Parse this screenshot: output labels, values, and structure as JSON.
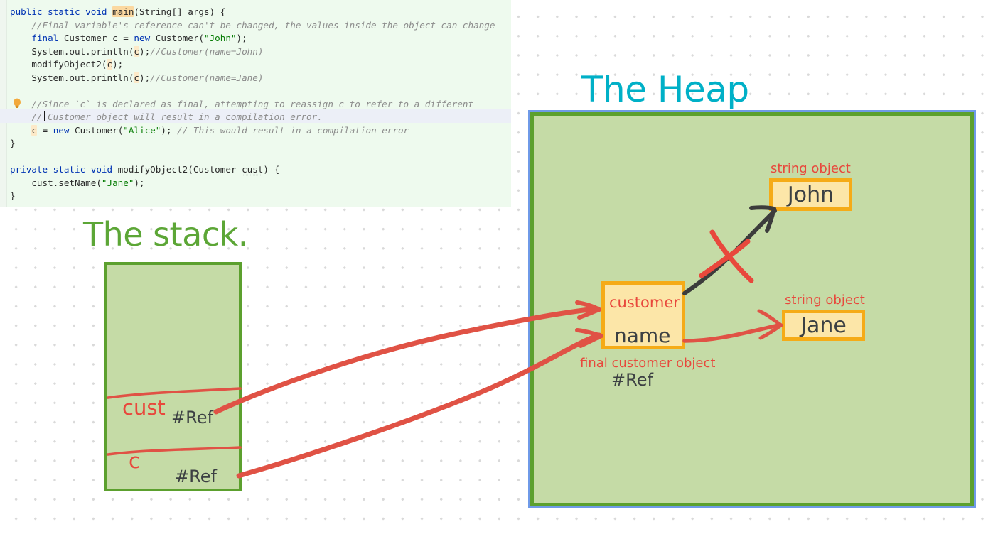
{
  "code": {
    "lines": [
      {
        "indent": 0,
        "tokens": [
          {
            "t": "public ",
            "c": "kw"
          },
          {
            "t": "static ",
            "c": "kw"
          },
          {
            "t": "void ",
            "c": "kw"
          },
          {
            "t": "main",
            "c": "hl-word"
          },
          {
            "t": "(String[] args) {",
            "c": "ident"
          }
        ]
      },
      {
        "indent": 1,
        "tokens": [
          {
            "t": "//Final variable's reference can't be changed, the values inside the object can change",
            "c": "cmt"
          }
        ]
      },
      {
        "indent": 1,
        "tokens": [
          {
            "t": "final ",
            "c": "kw"
          },
          {
            "t": "Customer c = ",
            "c": "ident"
          },
          {
            "t": "new ",
            "c": "kw"
          },
          {
            "t": "Customer(",
            "c": "ident"
          },
          {
            "t": "\"John\"",
            "c": "str"
          },
          {
            "t": ");",
            "c": "ident"
          }
        ]
      },
      {
        "indent": 1,
        "tokens": [
          {
            "t": "System.out.println(",
            "c": "ident"
          },
          {
            "t": "c",
            "c": "hl-soft"
          },
          {
            "t": ");",
            "c": "ident"
          },
          {
            "t": "//Customer(name=John)",
            "c": "cmt"
          }
        ]
      },
      {
        "indent": 1,
        "tokens": [
          {
            "t": "modifyObject2(",
            "c": "ident"
          },
          {
            "t": "c",
            "c": "hl-soft"
          },
          {
            "t": ");",
            "c": "ident"
          }
        ]
      },
      {
        "indent": 1,
        "tokens": [
          {
            "t": "System.out.println(",
            "c": "ident"
          },
          {
            "t": "c",
            "c": "hl-soft"
          },
          {
            "t": ");",
            "c": "ident"
          },
          {
            "t": "//Customer(name=Jane)",
            "c": "cmt"
          }
        ]
      },
      {
        "indent": 0,
        "tokens": []
      },
      {
        "indent": 1,
        "tokens": [
          {
            "t": "//Since `c` is declared as final, attempting to reassign c to refer to a different",
            "c": "cmt"
          }
        ]
      },
      {
        "indent": 1,
        "tokens": [
          {
            "t": "// Customer object will result in a compilation error.",
            "c": "cmt"
          }
        ]
      },
      {
        "indent": 1,
        "tokens": [
          {
            "t": "c",
            "c": "hl-soft"
          },
          {
            "t": " = ",
            "c": "ident"
          },
          {
            "t": "new ",
            "c": "kw"
          },
          {
            "t": "Customer(",
            "c": "ident"
          },
          {
            "t": "\"Alice\"",
            "c": "str"
          },
          {
            "t": "); ",
            "c": "ident"
          },
          {
            "t": "// This would result in a compilation error",
            "c": "cmt"
          }
        ]
      },
      {
        "indent": 0,
        "tokens": [
          {
            "t": "}",
            "c": "ident"
          }
        ]
      },
      {
        "indent": 0,
        "tokens": []
      },
      {
        "indent": 0,
        "tokens": [
          {
            "t": "private ",
            "c": "kw"
          },
          {
            "t": "static ",
            "c": "kw"
          },
          {
            "t": "void ",
            "c": "kw"
          },
          {
            "t": "modifyObject2(Customer ",
            "c": "ident"
          },
          {
            "t": "cust",
            "c": "wavy"
          },
          {
            "t": ") {",
            "c": "ident"
          }
        ]
      },
      {
        "indent": 1,
        "tokens": [
          {
            "t": "cust.setName(",
            "c": "ident"
          },
          {
            "t": "\"Jane\"",
            "c": "str"
          },
          {
            "t": ");",
            "c": "ident"
          }
        ]
      },
      {
        "indent": 0,
        "tokens": [
          {
            "t": "}",
            "c": "ident"
          }
        ]
      }
    ],
    "highlighted_line_index": 8,
    "bulb_icon": "lightbulb-icon",
    "background_color": "#eefaee"
  },
  "stack": {
    "title": "The stack.",
    "title_color": "#5ca636",
    "frames": [
      {
        "name": "cust",
        "ref": "#Ref"
      },
      {
        "name": "c",
        "ref": "#Ref"
      }
    ],
    "fill_color": "#c5dba6",
    "border_color": "#5ca02e"
  },
  "heap": {
    "title": "The Heap",
    "title_color": "#00b0c7",
    "fill_color": "#c5dba6",
    "border_color": "#5ca02e",
    "outer_border_color": "#6f9ae8",
    "objects": [
      {
        "id": "john",
        "caption": "string object",
        "value": "John"
      },
      {
        "id": "jane",
        "caption": "string object",
        "value": "Jane"
      },
      {
        "id": "customer",
        "title": "customer",
        "field": "name",
        "caption_line1": "final customer object",
        "caption_line2": "#Ref"
      }
    ],
    "object_fill": "#fce6a8",
    "object_border": "#f5ab17",
    "caption_color": "#e8483c",
    "value_color": "#3c4043"
  },
  "annotations": {
    "arrow_color_red": "#e05245",
    "arrow_color_dark": "#3c3c3c",
    "cross_out_color": "#e8483c",
    "cross_out_name": "invalidated-reference-cross"
  }
}
